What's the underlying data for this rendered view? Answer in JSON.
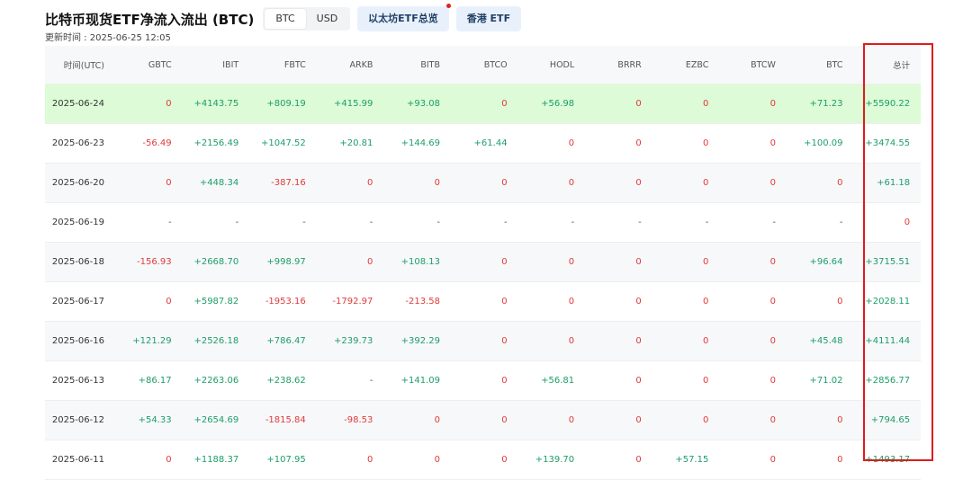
{
  "header": {
    "title": "比特币现货ETF净流入流出 (BTC)",
    "toggle": [
      "BTC",
      "USD"
    ],
    "active_toggle": "BTC",
    "btn_eth": "以太坊ETF总览",
    "btn_hk": "香港 ETF",
    "updated": "更新时间 : 2025-06-25 12:05"
  },
  "table": {
    "columns": [
      "时间(UTC)",
      "GBTC",
      "IBIT",
      "FBTC",
      "ARKB",
      "BITB",
      "BTCO",
      "HODL",
      "BRRR",
      "EZBC",
      "BTCW",
      "BTC",
      "总计"
    ],
    "rows": [
      [
        "2025-06-24",
        "0",
        "+4143.75",
        "+809.19",
        "+415.99",
        "+93.08",
        "0",
        "+56.98",
        "0",
        "0",
        "0",
        "+71.23",
        "+5590.22"
      ],
      [
        "2025-06-23",
        "-56.49",
        "+2156.49",
        "+1047.52",
        "+20.81",
        "+144.69",
        "+61.44",
        "0",
        "0",
        "0",
        "0",
        "+100.09",
        "+3474.55"
      ],
      [
        "2025-06-20",
        "0",
        "+448.34",
        "-387.16",
        "0",
        "0",
        "0",
        "0",
        "0",
        "0",
        "0",
        "0",
        "+61.18"
      ],
      [
        "2025-06-19",
        "-",
        "-",
        "-",
        "-",
        "-",
        "-",
        "-",
        "-",
        "-",
        "-",
        "-",
        "0"
      ],
      [
        "2025-06-18",
        "-156.93",
        "+2668.70",
        "+998.97",
        "0",
        "+108.13",
        "0",
        "0",
        "0",
        "0",
        "0",
        "+96.64",
        "+3715.51"
      ],
      [
        "2025-06-17",
        "0",
        "+5987.82",
        "-1953.16",
        "-1792.97",
        "-213.58",
        "0",
        "0",
        "0",
        "0",
        "0",
        "0",
        "+2028.11"
      ],
      [
        "2025-06-16",
        "+121.29",
        "+2526.18",
        "+786.47",
        "+239.73",
        "+392.29",
        "0",
        "0",
        "0",
        "0",
        "0",
        "+45.48",
        "+4111.44"
      ],
      [
        "2025-06-13",
        "+86.17",
        "+2263.06",
        "+238.62",
        "-",
        "+141.09",
        "0",
        "+56.81",
        "0",
        "0",
        "0",
        "+71.02",
        "+2856.77"
      ],
      [
        "2025-06-12",
        "+54.33",
        "+2654.69",
        "-1815.84",
        "-98.53",
        "0",
        "0",
        "0",
        "0",
        "0",
        "0",
        "0",
        "+794.65"
      ],
      [
        "2025-06-11",
        "0",
        "+1188.37",
        "+107.95",
        "0",
        "0",
        "0",
        "+139.70",
        "0",
        "+57.15",
        "0",
        "0",
        "+1493.17"
      ]
    ]
  },
  "colors": {
    "positive": "#1d9e69",
    "negative": "#e23a3a",
    "highlight_row": "#dcfbd6",
    "annotation_box": "#e01b1b"
  }
}
